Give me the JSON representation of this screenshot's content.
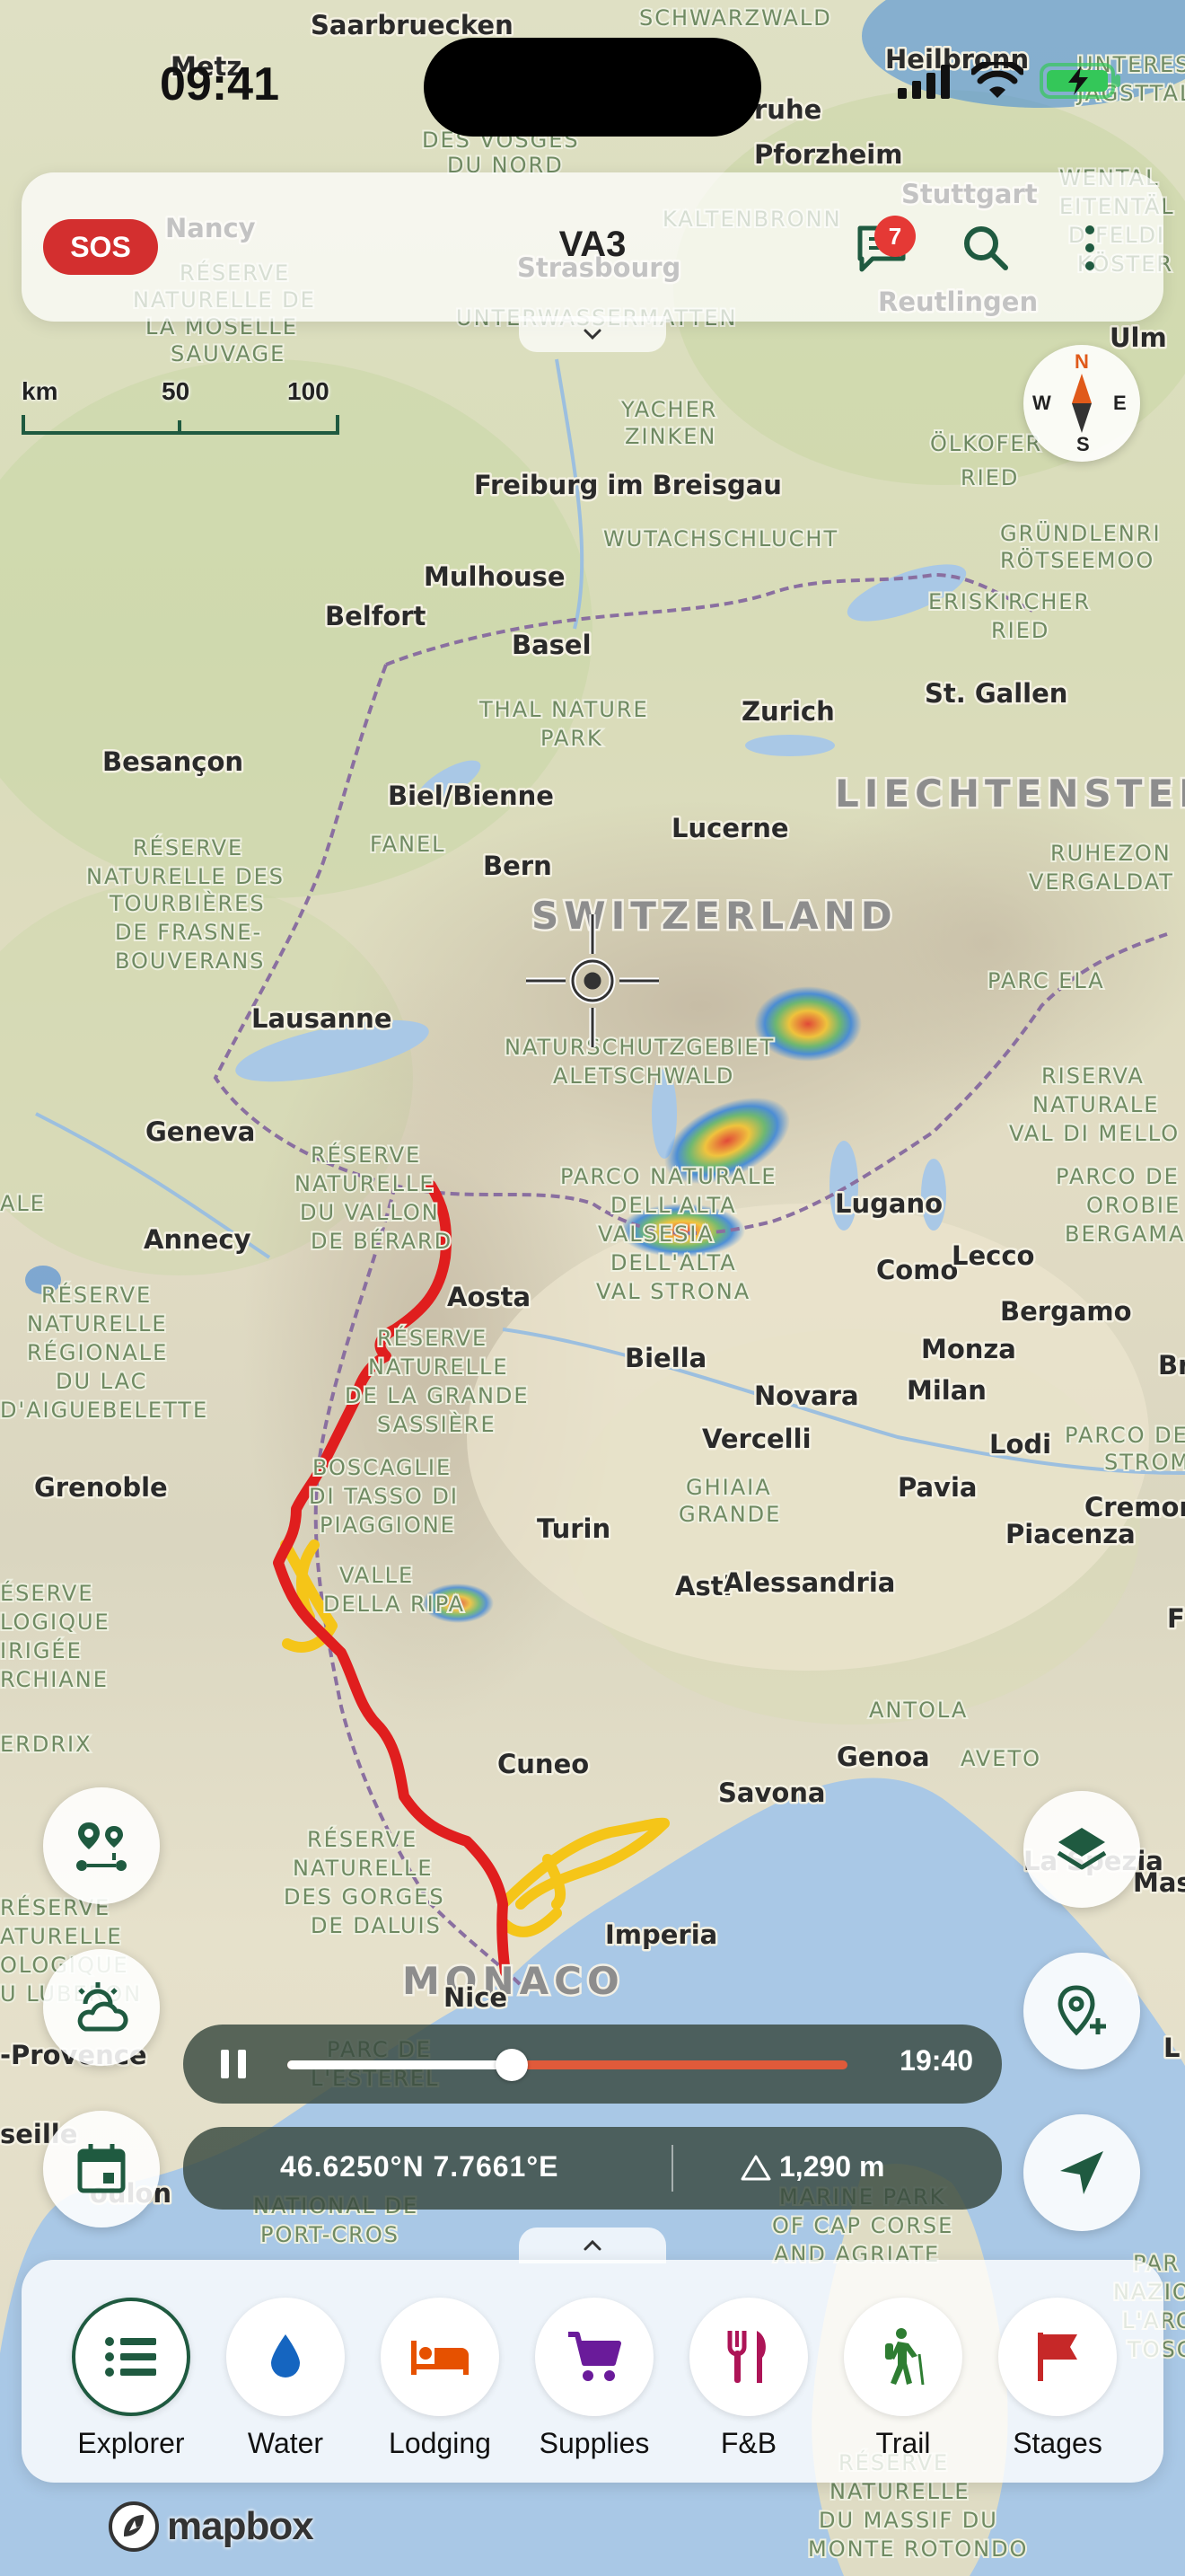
{
  "status": {
    "time": "09:41"
  },
  "header": {
    "sos_label": "SOS",
    "title": "VA3",
    "message_badge": "7"
  },
  "scale": {
    "unit": "km",
    "mid": "50",
    "max": "100"
  },
  "compass": {
    "n": "N",
    "s": "S",
    "e": "E",
    "w": "W"
  },
  "map": {
    "cities": [
      "Saarbruecken",
      "Metz",
      "Pforzheim",
      "Heilbronn",
      "Stuttgart",
      "Nancy",
      "Strasbourg",
      "Reutlingen",
      "Ulm",
      "Freiburg im Breisgau",
      "Mulhouse",
      "Belfort",
      "Basel",
      "Zurich",
      "St. Gallen",
      "Besançon",
      "Biel/Bienne",
      "Lucerne",
      "Bern",
      "Lausanne",
      "Geneva",
      "Annecy",
      "Aosta",
      "Lugano",
      "Como",
      "Lecco",
      "Bergamo",
      "Biella",
      "Monza",
      "Milan",
      "Novara",
      "Vercelli",
      "Lodi",
      "Grenoble",
      "Turin",
      "Pavia",
      "Piacenza",
      "Cremon",
      "Asti",
      "Alessandria",
      "Cuneo",
      "Genoa",
      "Savona",
      "Imperia",
      "Nice",
      "-Provence",
      "Bre",
      "La Spezia",
      "Mas",
      "seille",
      "oulon",
      "ruhe",
      "L",
      "F"
    ],
    "countries": [
      "SWITZERLAND",
      "LIECHTENSTEI",
      "MONACO"
    ],
    "parks": [
      "SCHWARZWALD",
      "DES VOSGES",
      "DU NORD",
      "KALTENBRONN",
      "RÉSERVE",
      "NATURELLE DE",
      "LA MOSELLE",
      "SAUVAGE",
      "UNTERWASSERMATTEN",
      "YACHER",
      "ZINKEN",
      "WUTACHSCHLUCHT",
      "ÖLKOFER",
      "RIED",
      "GRÜNDLENRIED",
      "RÖTSEEMOOS",
      "ERISKIRCHER",
      "RIED",
      "THAL NATURE",
      "PARK",
      "RÉSERVE",
      "NATURELLE DES",
      "TOURBIÈRES",
      "DE FRASNE-",
      "BOUVERANS",
      "FANEL",
      "RUHEZON",
      "VERGALDAT",
      "PARC ELA",
      "NATURSCHUTZGEBIET",
      "ALETSCHWALD",
      "RISERVA",
      "NATURALE",
      "VAL DI MELLO",
      "RÉSERVE",
      "NATURELLE",
      "DU VALLON",
      "DE BÉRARD",
      "PARCO NATURALE",
      "DELL'ALTA",
      "VALSESIA",
      "DELL'ALTA",
      "VAL STRONA",
      "PARCO",
      "OROBIE",
      "BERGAMAS",
      "ALE",
      "RÉSERVE",
      "NATURELLE",
      "RÉGIONALE",
      "DU LAC",
      "D'AIGUEBELETTE",
      "RÉSERVE",
      "NATURELLE",
      "DE LA GRANDE",
      "SASSIÈRE",
      "BOSCAGLIE",
      "DI TASSO DI",
      "PIAGGIONE",
      "GHIAIA",
      "GRANDE",
      "PARCO DE",
      "STROM",
      "VALLE",
      "DELLA RIPA",
      "ÉSERVE",
      "LOGIQUE",
      "IRIGÉE",
      "RCHIANE",
      "ERDRIX",
      "ANTOLA",
      "AVETO",
      "RÉSERVE",
      "NATURELLE",
      "DES GORGES",
      "DE DALUIS",
      "RÉSERVE",
      "ATURELLE",
      "OLOGIQUE",
      "U LUBERON",
      "PARC DE",
      "L'ESTEREL",
      "NATIONAL DE",
      "PORT-CROS",
      "MARINE PARK",
      "OF CAP CORSE",
      "AND AGRIATE",
      "RÉSERVE",
      "NATURELLE",
      "DU MASSIF DU",
      "MONTE ROTONDO",
      "PAR",
      "NAZIO",
      "L'ARC",
      "TOSC",
      "UNTERES",
      "JAGSTTAL",
      "WENTAL",
      "EITENTÄL",
      "D FELDI",
      "KÖSTER"
    ]
  },
  "playback": {
    "progress": 0.4,
    "end_time": "19:40"
  },
  "coords": {
    "position": "46.6250°N  7.7661°E",
    "altitude": "1,290 m"
  },
  "nav": [
    {
      "label": "Explorer",
      "icon": "list-icon"
    },
    {
      "label": "Water",
      "icon": "water-drop-icon"
    },
    {
      "label": "Lodging",
      "icon": "bed-icon"
    },
    {
      "label": "Supplies",
      "icon": "cart-icon"
    },
    {
      "label": "F&B",
      "icon": "fork-knife-icon"
    },
    {
      "label": "Trail",
      "icon": "hiker-icon"
    },
    {
      "label": "Stages",
      "icon": "flag-icon"
    }
  ],
  "attribution": {
    "logo_text": "mapbox"
  },
  "colors": {
    "route_red": "#e01e1e",
    "route_yellow": "#f5c518",
    "sos": "#d32f2f",
    "explorer_active": "#1f5a40",
    "water": "#1565c0",
    "lodging": "#e65100",
    "supplies": "#6a1b9a",
    "fnb": "#ad1457",
    "trail": "#2e7d32",
    "stages": "#c62828"
  }
}
